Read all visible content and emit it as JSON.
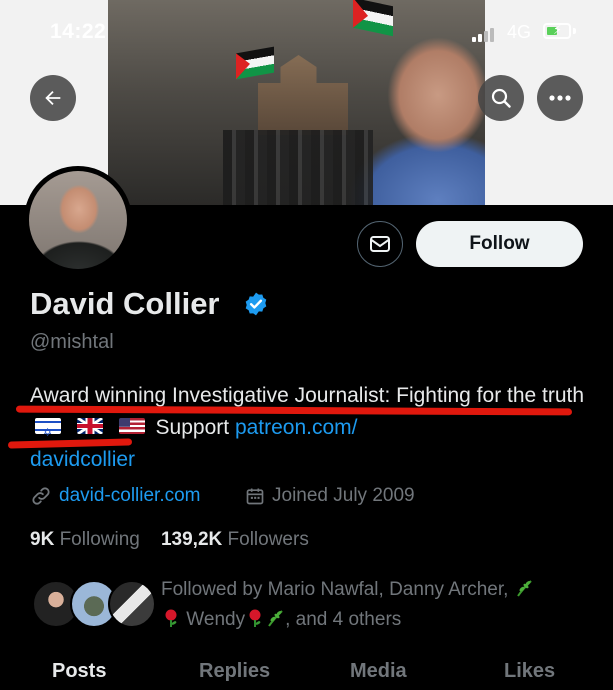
{
  "status_bar": {
    "time": "14:22",
    "network": "4G"
  },
  "profile": {
    "name": "David Collier",
    "handle": "@mishtal",
    "bio_text": "Award winning Investigative Journalist: Fighting for the truth",
    "bio_support": "Support",
    "bio_link_1": "patreon.com/",
    "bio_link_2": "davidcollier",
    "website": "david-collier.com",
    "joined": "Joined July 2009",
    "following_count": "9K",
    "following_label": "Following",
    "followers_count": "139,2K",
    "followers_label": "Followers",
    "followed_by_1": "Followed by Mario Nawfal, Danny Archer,",
    "followed_by_2": "Wendy",
    "followed_by_3": ", and 4 others"
  },
  "actions": {
    "follow_label": "Follow"
  },
  "tabs": [
    {
      "label": "Posts"
    },
    {
      "label": "Replies"
    },
    {
      "label": "Media"
    },
    {
      "label": "Likes"
    }
  ],
  "colors": {
    "accent": "#1d9bf0",
    "underline": "#e0180d",
    "background": "#000000"
  },
  "icons": [
    "back-arrow-icon",
    "search-icon",
    "more-icon",
    "message-icon",
    "verified-badge-icon",
    "link-icon",
    "calendar-icon",
    "rose-icon",
    "herb-icon"
  ]
}
